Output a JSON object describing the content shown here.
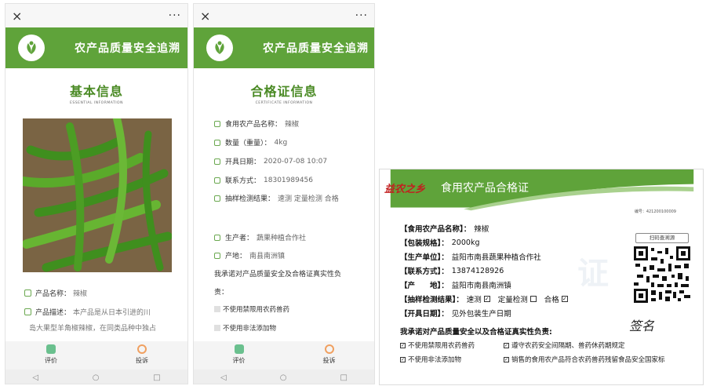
{
  "screen1": {
    "close_icon": "×",
    "more_icon": "···",
    "banner_title": "农产品质量安全追溯",
    "section_title": "基本信息",
    "section_subtitle": "ESSENTIAL INFORMATION",
    "product_name_label": "产品名称：",
    "product_name_value": "辣椒",
    "product_desc_label": "产品描述：",
    "product_desc_value": "本产品是从日本引进的川",
    "product_desc_line2": "岛大果型羊角椒辣椒，在同类品种中独占",
    "tabs": [
      {
        "label": "评价"
      },
      {
        "label": "投诉"
      }
    ],
    "nav": [
      "◁",
      "○",
      "□"
    ]
  },
  "screen2": {
    "close_icon": "×",
    "more_icon": "···",
    "banner_title": "农产品质量安全追溯",
    "section_title": "合格证信息",
    "section_subtitle": "CERTIFICATE INFORMATION",
    "fields": [
      {
        "label": "食用农产品名称：",
        "value": "辣椒"
      },
      {
        "label": "数量（重量）：",
        "value": "4kg"
      },
      {
        "label": "开具日期：",
        "value": "2020-07-08 10:07"
      },
      {
        "label": "联系方式：",
        "value": "18301989456"
      },
      {
        "label": "抽样检测结果：",
        "value": "速测 定量检测 合格"
      },
      {
        "label": "生产者：",
        "value": "蔬果种植合作社"
      },
      {
        "label": "产地：",
        "value": "南县南洲镇"
      }
    ],
    "pledge": "我承诺对产品质量安全及合格证真实性负",
    "pledge_line2": "责：",
    "checks": [
      "不使用禁限用农药兽药",
      "不使用非法添加物"
    ],
    "tabs": [
      {
        "label": "评价"
      },
      {
        "label": "投诉"
      }
    ],
    "nav": [
      "◁",
      "○",
      "□"
    ]
  },
  "cert": {
    "brand": "益农之乡",
    "title": "食用农产品合格证",
    "serial": "编号：421200100009",
    "scan_button": "扫码查溯源",
    "fields": [
      {
        "label": "【食用农产品名称】：",
        "value": "辣椒"
      },
      {
        "label": "【包装规格】：",
        "value": "2000kg"
      },
      {
        "label": "【生产单位】：",
        "value": "益阳市南县蔬果种植合作社"
      },
      {
        "label": "【联系方式】：",
        "value": "13874128926"
      },
      {
        "label": "【产　　地】：",
        "value": "益阳市南县南洲镇"
      }
    ],
    "test_label": "【抽样检测结果】：",
    "test_options": [
      {
        "label": "速测",
        "checked": true
      },
      {
        "label": "定量检测",
        "checked": false
      },
      {
        "label": "合格",
        "checked": true
      }
    ],
    "issue_label": "【开具日期】：",
    "issue_value": "见外包装生产日期",
    "pledge": "我承诺对产品质量安全以及合格证真实性负责:",
    "signature": "签名",
    "checks": [
      "不使用禁限用农药兽药",
      "遵守农药安全间隔期、兽药休药期规定",
      "不使用非法添加物",
      "销售的食用农产品符合农药兽药残留食品安全国家标"
    ],
    "colors": {
      "green": "#5fa33a",
      "brand_red": "#c21f1f"
    }
  }
}
